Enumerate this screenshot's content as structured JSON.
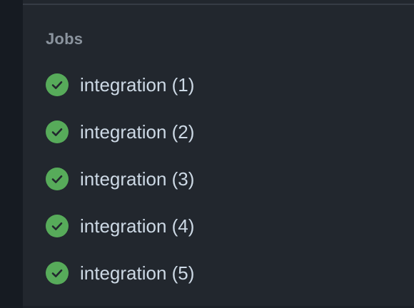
{
  "section": {
    "title": "Jobs"
  },
  "jobs": [
    {
      "label": "integration (1)",
      "status": "success"
    },
    {
      "label": "integration (2)",
      "status": "success"
    },
    {
      "label": "integration (3)",
      "status": "success"
    },
    {
      "label": "integration (4)",
      "status": "success"
    },
    {
      "label": "integration (5)",
      "status": "success"
    }
  ],
  "icons": {
    "status": "check-circle-icon"
  },
  "colors": {
    "success": "#57ab5a",
    "background": "#22272e",
    "text": "#cdd9e5",
    "muted": "#8b949e"
  }
}
